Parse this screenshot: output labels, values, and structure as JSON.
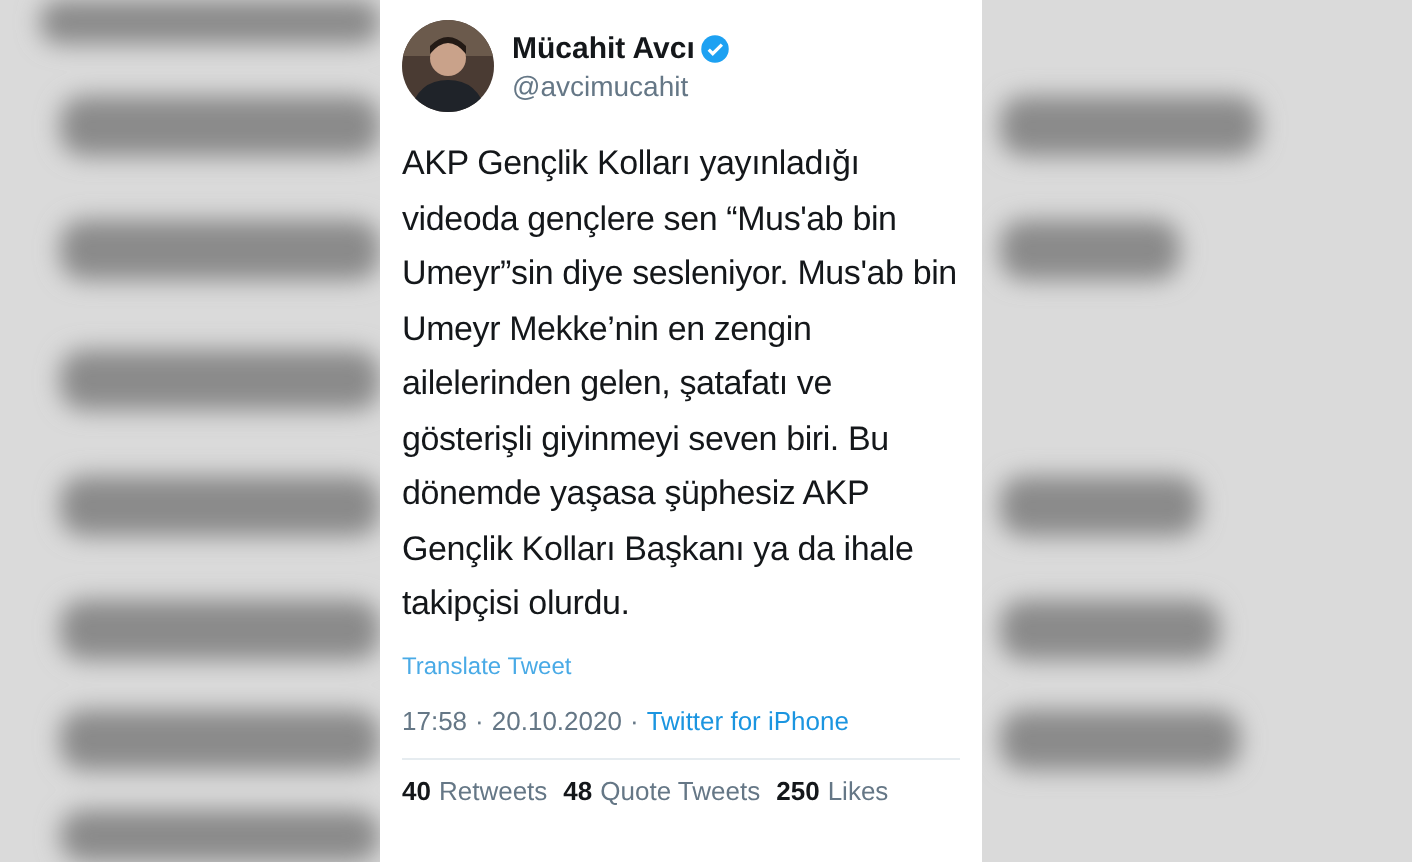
{
  "author": {
    "name": "Mücahit Avcı",
    "verified": true,
    "handle": "@avcimucahit"
  },
  "tweet": {
    "text": "AKP Gençlik Kolları yayınladığı videoda gençlere sen “Mus'ab bin Umeyr”sin diye sesleniyor. Mus'ab bin Umeyr Mekke’nin en zengin ailelerinden gelen, şatafatı ve gösterişli giyinmeyi seven biri. Bu dönemde yaşasa şüphesiz AKP Gençlik Kolları Başkanı ya da ihale takipçisi olurdu."
  },
  "translate_link": "Translate Tweet",
  "meta": {
    "time": "17:58",
    "separator_1": "·",
    "date": "20.10.2020",
    "separator_2": "·",
    "source": "Twitter for iPhone"
  },
  "stats": [
    {
      "count": "40",
      "label": "Retweets"
    },
    {
      "count": "48",
      "label": "Quote Tweets"
    },
    {
      "count": "250",
      "label": "Likes"
    }
  ]
}
